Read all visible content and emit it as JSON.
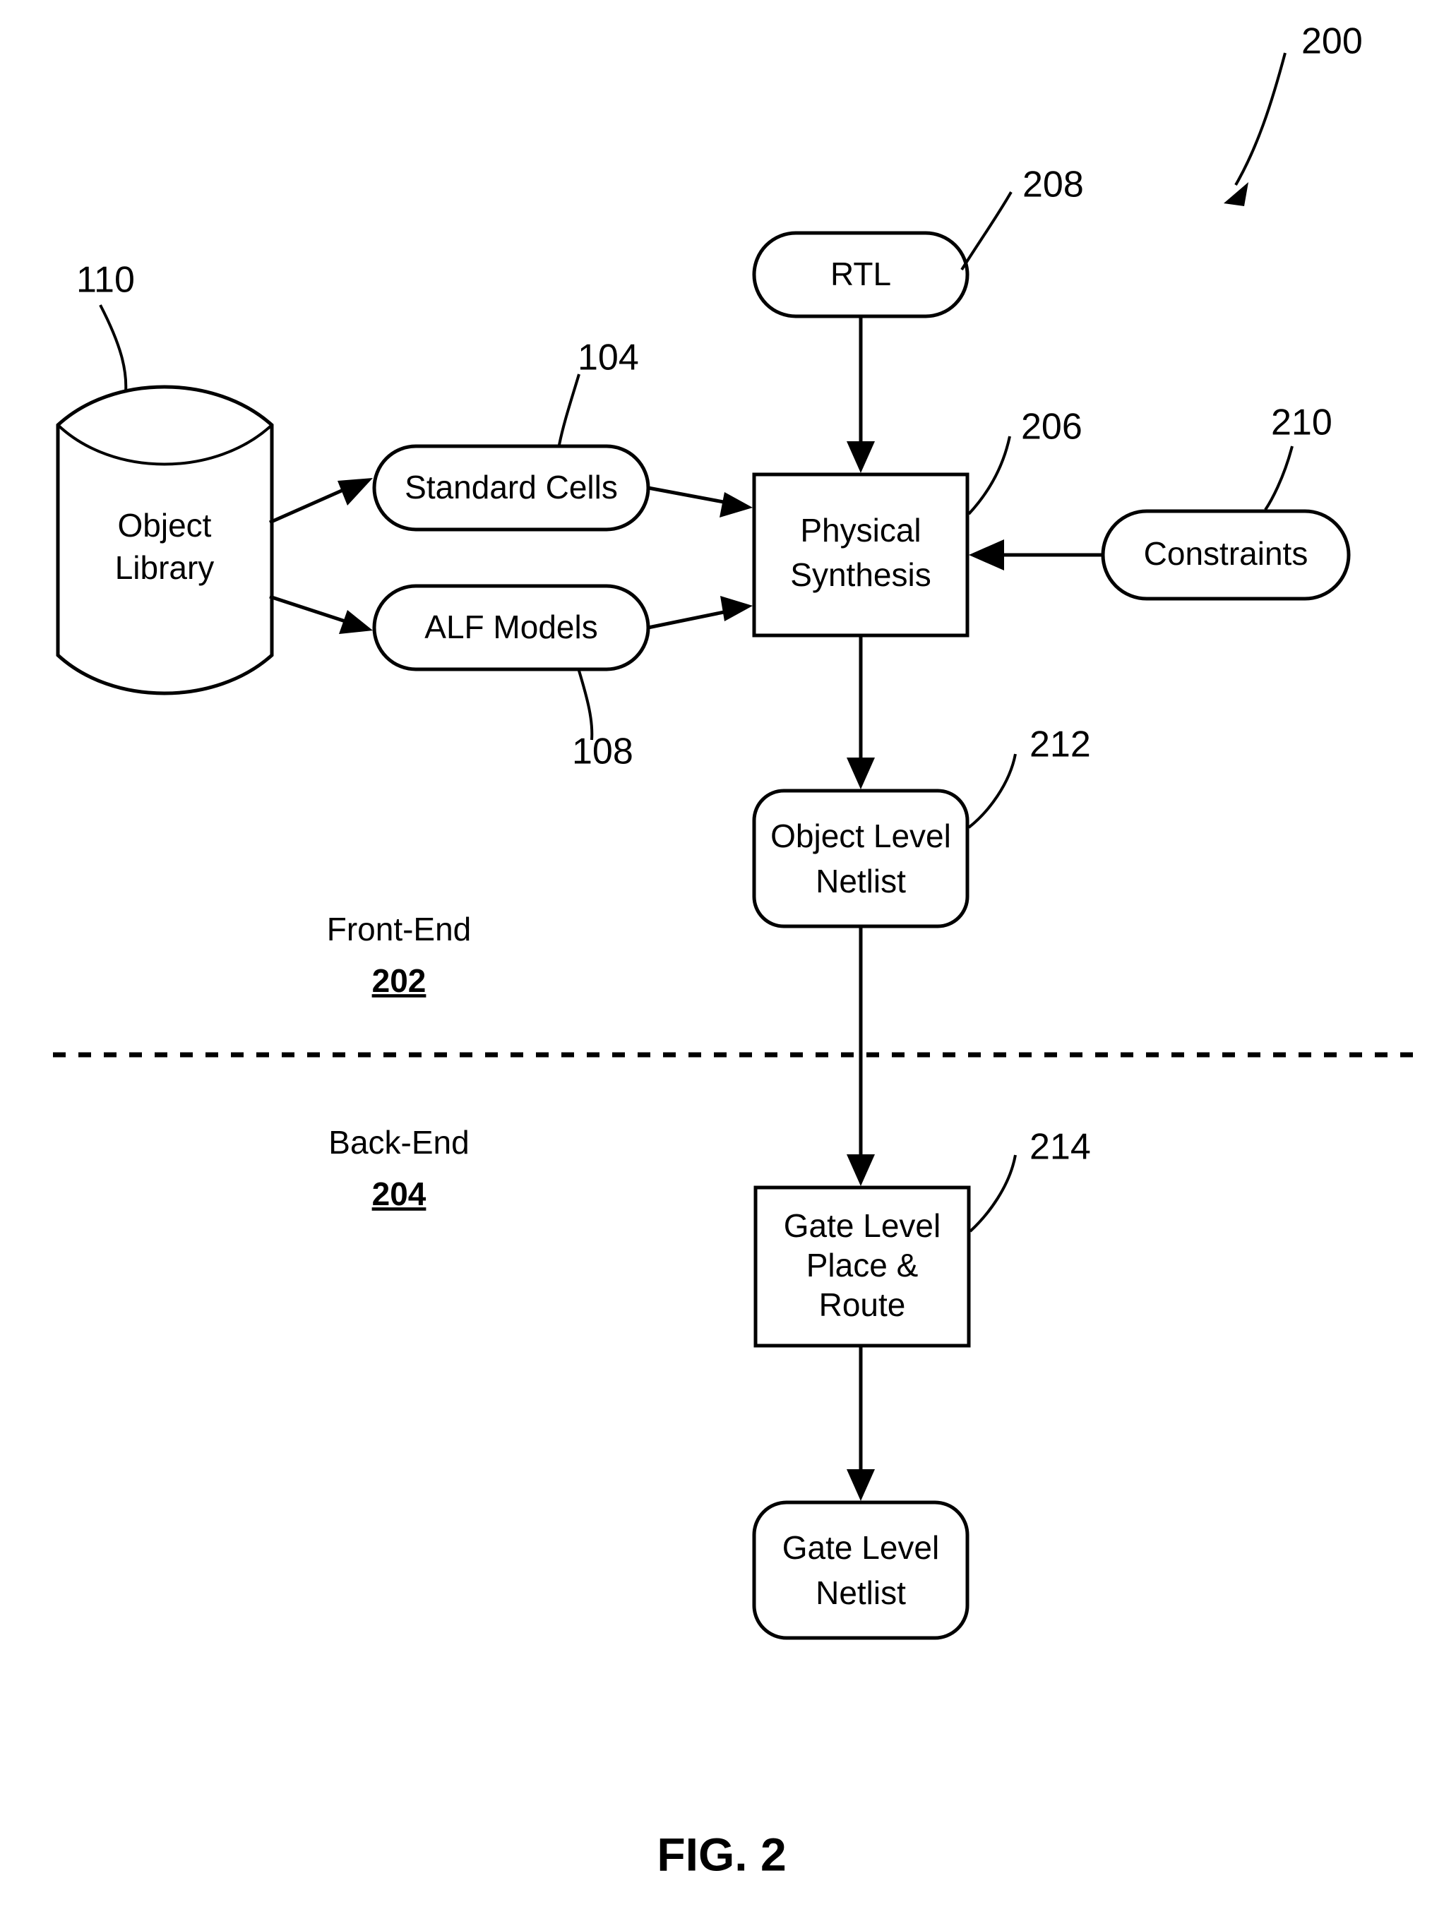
{
  "figure": {
    "caption": "FIG. 2",
    "overall_ref": "200"
  },
  "nodes": [
    {
      "id": "object-library",
      "shape": "cylinder",
      "lines": [
        "Object",
        "Library"
      ],
      "ref": "110"
    },
    {
      "id": "standard-cells",
      "shape": "pill",
      "lines": [
        "Standard Cells"
      ],
      "ref": "104"
    },
    {
      "id": "alf-models",
      "shape": "pill",
      "lines": [
        "ALF Models"
      ],
      "ref": "108"
    },
    {
      "id": "rtl",
      "shape": "pill",
      "lines": [
        "RTL"
      ],
      "ref": "208"
    },
    {
      "id": "physical-synthesis",
      "shape": "rect",
      "lines": [
        "Physical",
        "Synthesis"
      ],
      "ref": "206"
    },
    {
      "id": "constraints",
      "shape": "pill",
      "lines": [
        "Constraints"
      ],
      "ref": "210"
    },
    {
      "id": "object-level-netlist",
      "shape": "rounded-rect",
      "lines": [
        "Object Level",
        "Netlist"
      ],
      "ref": "212"
    },
    {
      "id": "gate-level-place-route",
      "shape": "rect",
      "lines": [
        "Gate Level",
        "Place &",
        "Route"
      ],
      "ref": "214"
    },
    {
      "id": "gate-level-netlist",
      "shape": "rounded-rect",
      "lines": [
        "Gate Level",
        "Netlist"
      ],
      "ref": ""
    }
  ],
  "node_text": {
    "object_library_line1": "Object",
    "object_library_line2": "Library",
    "standard_cells": "Standard Cells",
    "alf_models": "ALF Models",
    "rtl": "RTL",
    "physical_synthesis_line1": "Physical",
    "physical_synthesis_line2": "Synthesis",
    "constraints": "Constraints",
    "object_level_netlist_line1": "Object Level",
    "object_level_netlist_line2": "Netlist",
    "gate_level_pr_line1": "Gate Level",
    "gate_level_pr_line2": "Place &",
    "gate_level_pr_line3": "Route",
    "gate_level_netlist_line1": "Gate Level",
    "gate_level_netlist_line2": "Netlist"
  },
  "reference_numerals": {
    "overall": "200",
    "object_library": "110",
    "standard_cells": "104",
    "alf_models": "108",
    "rtl": "208",
    "physical_synthesis": "206",
    "constraints": "210",
    "object_level_netlist": "212",
    "gate_level_place_route": "214"
  },
  "stages": {
    "front_end_label": "Front-End",
    "front_end_num": "202",
    "back_end_label": "Back-End",
    "back_end_num": "204"
  },
  "colors": {
    "stroke": "#000000",
    "fill": "#ffffff",
    "background": "#ffffff"
  }
}
